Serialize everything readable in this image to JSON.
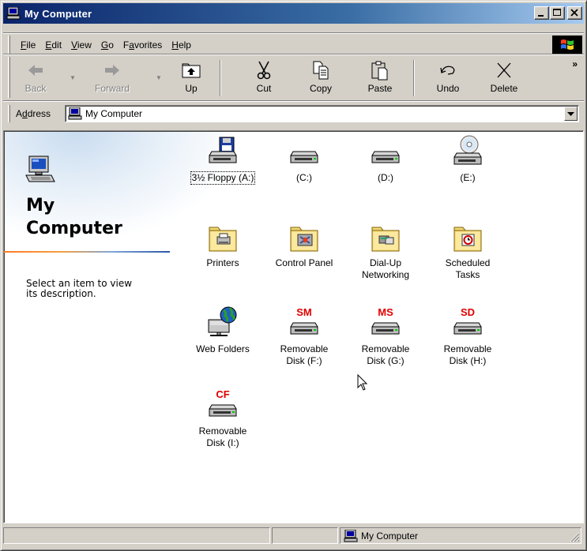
{
  "window": {
    "title": "My Computer"
  },
  "menu": [
    "File",
    "Edit",
    "View",
    "Go",
    "Favorites",
    "Help"
  ],
  "menu_mnemonics": [
    "F",
    "E",
    "V",
    "G",
    "a",
    "H"
  ],
  "toolbar": {
    "back": "Back",
    "forward": "Forward",
    "up": "Up",
    "cut": "Cut",
    "copy": "Copy",
    "paste": "Paste",
    "undo": "Undo",
    "delete": "Delete",
    "more": "»"
  },
  "address": {
    "label": "Address",
    "value": "My Computer"
  },
  "panel": {
    "title_line1": "My",
    "title_line2": "Computer",
    "description": "Select an item to view its description."
  },
  "items": [
    {
      "name": "floppy",
      "line1": "3½ Floppy (A:)",
      "line2": "",
      "icon": "floppy-drive-icon"
    },
    {
      "name": "drive-c",
      "line1": "(C:)",
      "line2": "",
      "icon": "hard-drive-icon"
    },
    {
      "name": "drive-d",
      "line1": "(D:)",
      "line2": "",
      "icon": "hard-drive-icon"
    },
    {
      "name": "drive-e",
      "line1": "(E:)",
      "line2": "",
      "icon": "cd-drive-icon"
    },
    {
      "name": "printers",
      "line1": "Printers",
      "line2": "",
      "icon": "printers-folder-icon"
    },
    {
      "name": "control-panel",
      "line1": "Control Panel",
      "line2": "",
      "icon": "control-panel-folder-icon"
    },
    {
      "name": "dialup",
      "line1": "Dial-Up",
      "line2": "Networking",
      "icon": "dialup-folder-icon"
    },
    {
      "name": "scheduled-tasks",
      "line1": "Scheduled",
      "line2": "Tasks",
      "icon": "scheduled-tasks-folder-icon"
    },
    {
      "name": "web-folders",
      "line1": "Web Folders",
      "line2": "",
      "icon": "web-folders-icon"
    },
    {
      "name": "disk-f",
      "line1": "Removable",
      "line2": "Disk (F:)",
      "badge": "SM",
      "icon": "removable-disk-icon"
    },
    {
      "name": "disk-g",
      "line1": "Removable",
      "line2": "Disk (G:)",
      "badge": "MS",
      "icon": "removable-disk-icon"
    },
    {
      "name": "disk-h",
      "line1": "Removable",
      "line2": "Disk (H:)",
      "badge": "SD",
      "icon": "removable-disk-icon"
    },
    {
      "name": "disk-i",
      "line1": "Removable",
      "line2": "Disk (I:)",
      "badge": "CF",
      "icon": "removable-disk-icon"
    }
  ],
  "status": {
    "location": "My Computer"
  },
  "colors": {
    "titlebar_start": "#0a246a",
    "titlebar_end": "#a6caf0",
    "face": "#d4d0c8",
    "badge_red": "#e00000"
  }
}
